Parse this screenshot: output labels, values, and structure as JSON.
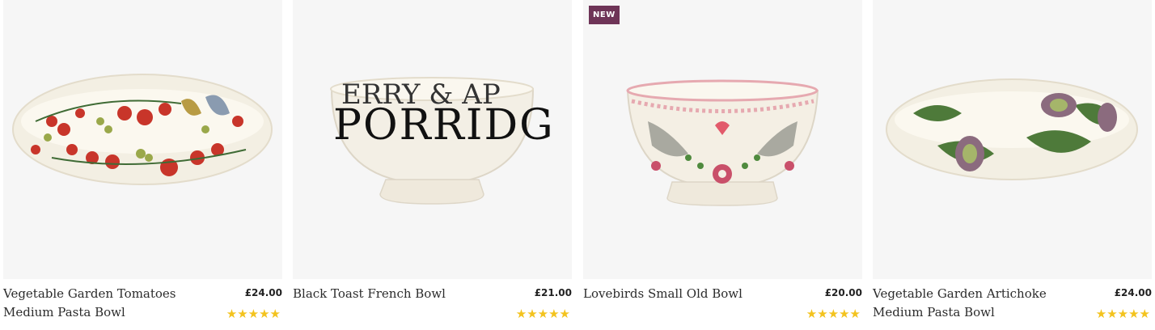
{
  "products": [
    {
      "title": "Vegetable Garden Tomatoes Medium Pasta Bowl",
      "price": "£24.00",
      "rating": 5,
      "stars": "★★★★★",
      "badge": ""
    },
    {
      "title": "Black Toast French Bowl",
      "price": "£21.00",
      "rating": 5,
      "stars": "★★★★★",
      "badge": ""
    },
    {
      "title": "Lovebirds Small Old Bowl",
      "price": "£20.00",
      "rating": 5,
      "stars": "★★★★★",
      "badge": "NEW"
    },
    {
      "title": "Vegetable Garden Artichoke Medium Pasta Bowl",
      "price": "£24.00",
      "rating": 5,
      "stars": "★★★★★",
      "badge": ""
    }
  ],
  "bowl_text": {
    "line1": "ERRY & AP",
    "line2": "PORRIDG"
  },
  "colors": {
    "badge": "#6e3457",
    "star": "#f3c31e",
    "tile_bg": "#f6f6f6"
  }
}
